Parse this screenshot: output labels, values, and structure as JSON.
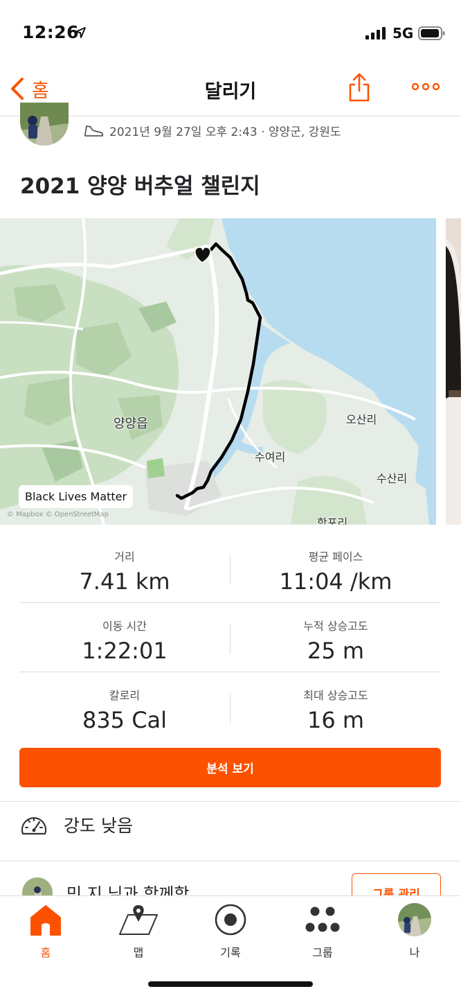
{
  "status_bar": {
    "time": "12:26",
    "network": "5G",
    "icons": [
      "location-arrow-icon",
      "signal-icon",
      "battery-icon"
    ]
  },
  "nav": {
    "back_label": "홈",
    "title": "달리기",
    "icons": [
      "chevron-left-icon",
      "share-icon",
      "more-icon"
    ]
  },
  "activity": {
    "meta": "2021년 9월 27일 오후 2:43 · 양양군, 강원도",
    "title": "2021 양양 버추얼 챌린지"
  },
  "map": {
    "labels": {
      "town": "양양읍",
      "osanri": "오산리",
      "suyeori": "수여리",
      "susanri": "수산리",
      "hakpori": "학포리"
    },
    "badge": "Black Lives Matter",
    "attribution": "© Mapbox © OpenStreetMap",
    "colors": {
      "water": "#b7dcf0",
      "land": "#e6ece6",
      "forest": "#c9dfc1",
      "route": "#000000"
    }
  },
  "stats": [
    [
      {
        "label": "거리",
        "value": "7.41 km"
      },
      {
        "label": "평균 페이스",
        "value": "11:04 /km"
      }
    ],
    [
      {
        "label": "이동 시간",
        "value": "1:22:01"
      },
      {
        "label": "누적 상승고도",
        "value": "25 m"
      }
    ],
    [
      {
        "label": "칼로리",
        "value": "835 Cal"
      },
      {
        "label": "최대 상승고도",
        "value": "16 m"
      }
    ]
  ],
  "analysis_button": "분석 보기",
  "intensity": {
    "label": "강도 낮음",
    "icon": "gauge-icon"
  },
  "group": {
    "text": "민 지 님과 함께함",
    "button": "그룹 관리"
  },
  "tabs": [
    {
      "label": "홈",
      "icon": "home-icon",
      "active": true
    },
    {
      "label": "맵",
      "icon": "map-icon",
      "active": false
    },
    {
      "label": "기록",
      "icon": "record-icon",
      "active": false
    },
    {
      "label": "그룹",
      "icon": "groups-icon",
      "active": false
    },
    {
      "label": "나",
      "icon": "profile-avatar",
      "active": false
    }
  ],
  "accent_color": "#fc5200"
}
